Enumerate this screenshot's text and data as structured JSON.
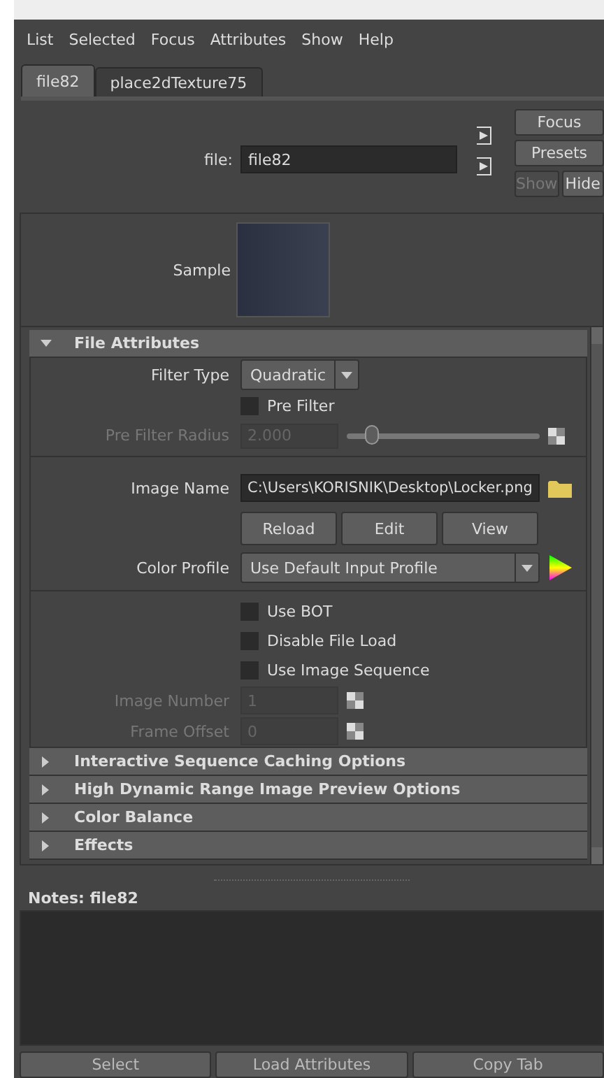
{
  "menu": [
    "List",
    "Selected",
    "Focus",
    "Attributes",
    "Show",
    "Help"
  ],
  "tabs": [
    {
      "label": "file82",
      "selected": true
    },
    {
      "label": "place2dTexture75",
      "selected": false
    }
  ],
  "node": {
    "label": "file:",
    "value": "file82"
  },
  "side_buttons": [
    {
      "label": "Focus",
      "disabled": false
    },
    {
      "label": "Presets",
      "disabled": false
    }
  ],
  "show_hide": [
    {
      "label": "Show",
      "disabled": true
    },
    {
      "label": "Hide",
      "disabled": false
    }
  ],
  "sample": {
    "label": "Sample"
  },
  "sections": [
    {
      "title": "File Attributes",
      "expanded": true,
      "rows": [
        {
          "kind": "dropdown",
          "label": "Filter Type",
          "value": "Quadratic"
        },
        {
          "kind": "checkbox",
          "label": "Pre Filter",
          "checked": false
        },
        {
          "kind": "slider",
          "label": "Pre Filter Radius",
          "value": "2.000",
          "level": 0.13,
          "disabled": true
        },
        {
          "kind": "separator"
        },
        {
          "kind": "path",
          "label": "Image Name",
          "value": "C:\\Users\\KORISNIK\\Desktop\\Locker.png"
        },
        {
          "kind": "buttons",
          "buttons": [
            "Reload",
            "Edit",
            "View"
          ]
        },
        {
          "kind": "profile",
          "label": "Color Profile",
          "value": "Use Default Input Profile"
        },
        {
          "kind": "separator"
        },
        {
          "kind": "checkbox",
          "label": "Use BOT",
          "checked": false
        },
        {
          "kind": "checkbox",
          "label": "Disable File Load",
          "checked": false
        },
        {
          "kind": "checkbox",
          "label": "Use Image Sequence",
          "checked": false
        },
        {
          "kind": "number",
          "label": "Image Number",
          "value": "1",
          "disabled": true
        },
        {
          "kind": "number",
          "label": "Frame Offset",
          "value": "0",
          "disabled": true
        }
      ]
    },
    {
      "title": "Interactive Sequence Caching Options",
      "expanded": false
    },
    {
      "title": "High Dynamic Range Image Preview Options",
      "expanded": false
    },
    {
      "title": "Color Balance",
      "expanded": false
    },
    {
      "title": "Effects",
      "expanded": false
    }
  ],
  "notes": {
    "title": "Notes:  file82"
  },
  "bottom_buttons": [
    "Select",
    "Load Attributes",
    "Copy Tab"
  ]
}
